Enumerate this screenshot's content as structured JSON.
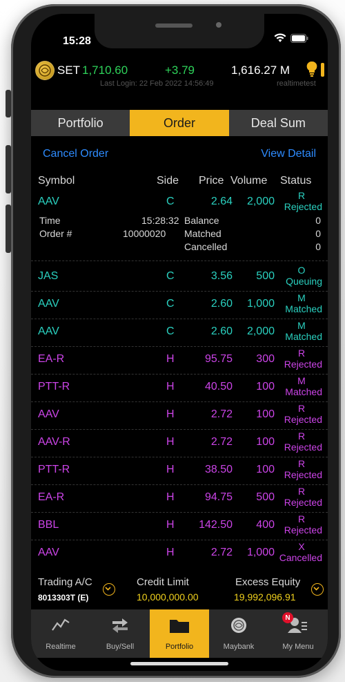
{
  "status_bar": {
    "time": "15:28"
  },
  "ticker": {
    "market": "SET",
    "index": "1,710.60",
    "change": "+3.79",
    "value": "1,616.27 M",
    "last_login": "Last Login: 22 Feb 2022 14:56:49",
    "username": "realtimetest"
  },
  "tabs": [
    {
      "label": "Portfolio",
      "active": false
    },
    {
      "label": "Order",
      "active": true
    },
    {
      "label": "Deal Sum",
      "active": false
    }
  ],
  "actions": {
    "cancel_order": "Cancel Order",
    "view_detail": "View Detail"
  },
  "columns": {
    "symbol": "Symbol",
    "side": "Side",
    "price": "Price",
    "volume": "Volume",
    "status": "Status"
  },
  "expanded_detail": {
    "time_label": "Time",
    "time_value": "15:28:32",
    "order_label": "Order #",
    "order_value": "10000020",
    "balance_label": "Balance",
    "balance_value": "0",
    "matched_label": "Matched",
    "matched_value": "0",
    "cancelled_label": "Cancelled",
    "cancelled_value": "0"
  },
  "orders": [
    {
      "symbol": "AAV",
      "side": "C",
      "price": "2.64",
      "volume": "2,000",
      "status_code": "R",
      "status": "Rejected"
    },
    {
      "symbol": "JAS",
      "side": "C",
      "price": "3.56",
      "volume": "500",
      "status_code": "O",
      "status": "Queuing"
    },
    {
      "symbol": "AAV",
      "side": "C",
      "price": "2.60",
      "volume": "1,000",
      "status_code": "M",
      "status": "Matched"
    },
    {
      "symbol": "AAV",
      "side": "C",
      "price": "2.60",
      "volume": "2,000",
      "status_code": "M",
      "status": "Matched"
    },
    {
      "symbol": "EA-R",
      "side": "H",
      "price": "95.75",
      "volume": "300",
      "status_code": "R",
      "status": "Rejected"
    },
    {
      "symbol": "PTT-R",
      "side": "H",
      "price": "40.50",
      "volume": "100",
      "status_code": "M",
      "status": "Matched"
    },
    {
      "symbol": "AAV",
      "side": "H",
      "price": "2.72",
      "volume": "100",
      "status_code": "R",
      "status": "Rejected"
    },
    {
      "symbol": "AAV-R",
      "side": "H",
      "price": "2.72",
      "volume": "100",
      "status_code": "R",
      "status": "Rejected"
    },
    {
      "symbol": "PTT-R",
      "side": "H",
      "price": "38.50",
      "volume": "100",
      "status_code": "R",
      "status": "Rejected"
    },
    {
      "symbol": "EA-R",
      "side": "H",
      "price": "94.75",
      "volume": "500",
      "status_code": "R",
      "status": "Rejected"
    },
    {
      "symbol": "BBL",
      "side": "H",
      "price": "142.50",
      "volume": "400",
      "status_code": "R",
      "status": "Rejected"
    },
    {
      "symbol": "AAV",
      "side": "H",
      "price": "2.72",
      "volume": "1,000",
      "status_code": "X",
      "status": "Cancelled"
    }
  ],
  "account": {
    "trading_label": "Trading A/C",
    "trading_value": "8013303T (E)",
    "credit_label": "Credit Limit",
    "credit_value": "10,000,000.00",
    "equity_label": "Excess Equity",
    "equity_value": "19,992,096.91"
  },
  "bottom_nav": [
    {
      "label": "Realtime",
      "icon": "chart-line-icon"
    },
    {
      "label": "Buy/Sell",
      "icon": "swap-arrows-icon"
    },
    {
      "label": "Portfolio",
      "icon": "folder-icon",
      "active": true
    },
    {
      "label": "Maybank",
      "icon": "maybank-logo-icon"
    },
    {
      "label": "My Menu",
      "icon": "user-menu-icon",
      "badge": "N"
    }
  ],
  "colors": {
    "accent": "#f2b51d",
    "cash_side": "#2ad1c0",
    "other_side": "#cc44e8",
    "up": "#2ed35a",
    "link": "#2e8cff"
  }
}
